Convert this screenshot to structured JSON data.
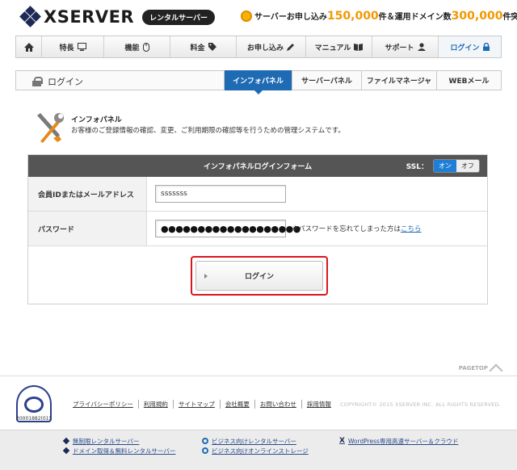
{
  "header": {
    "logo_text": "XSERVER",
    "badge": "レンタルサーバー",
    "promo": {
      "prefix": "サーバーお申し込み",
      "count1": "150,000",
      "mid": "件＆運用ドメイン数",
      "count2": "300,000",
      "suffix": "件突破!!"
    }
  },
  "gnav": [
    {
      "label": "特長",
      "icon": "monitor-icon"
    },
    {
      "label": "機能",
      "icon": "mouse-icon"
    },
    {
      "label": "料金",
      "icon": "tag-icon"
    },
    {
      "label": "お申し込み",
      "icon": "pencil-icon"
    },
    {
      "label": "マニュアル",
      "icon": "book-icon"
    },
    {
      "label": "サポート",
      "icon": "user-icon"
    },
    {
      "label": "ログイン",
      "icon": "lock-icon"
    }
  ],
  "subhead": {
    "title": "ログイン",
    "tabs": [
      "インフォパネル",
      "サーバーパネル",
      "ファイルマネージャ",
      "WEBメール"
    ]
  },
  "intro": {
    "title": "インフォパネル",
    "desc": "お客様のご登録情報の確認、変更、ご利用期限の確認等を行うための管理システムです。"
  },
  "form": {
    "title": "インフォパネルログインフォーム",
    "ssl_label": "SSL：",
    "ssl_on": "オン",
    "ssl_off": "オフ",
    "id_label": "会員IDまたはメールアドレス",
    "id_value": "sssssss",
    "pw_label": "パスワード",
    "pw_value": "●●●●●●●●●●●●●●●●●●●",
    "forgot_text": "※パスワードを忘れてしまった方は",
    "forgot_link": "こちら",
    "login_label": "ログイン"
  },
  "pagetop": "PAGETOP",
  "footer": {
    "privacy_num": "20001882(01)",
    "links": [
      "プライバシーポリシー",
      "利用規約",
      "サイトマップ",
      "会社概要",
      "お問い合わせ",
      "採用情報"
    ],
    "copyright": "COPYRIGHT© 2015 XSERVER INC. ALL RIGHTS RESERVED."
  },
  "services": [
    {
      "label": "無制限レンタルサーバー",
      "icon": "diamond"
    },
    {
      "label": "ドメイン取得＆無料レンタルサーバー",
      "icon": "diamond"
    },
    {
      "label": "ビジネス向けレンタルサーバー",
      "icon": "circle"
    },
    {
      "label": "ビジネス向けオンラインストレージ",
      "icon": "circle"
    },
    {
      "label": "WordPress専用高速サーバー＆クラウド",
      "icon": "x"
    }
  ]
}
